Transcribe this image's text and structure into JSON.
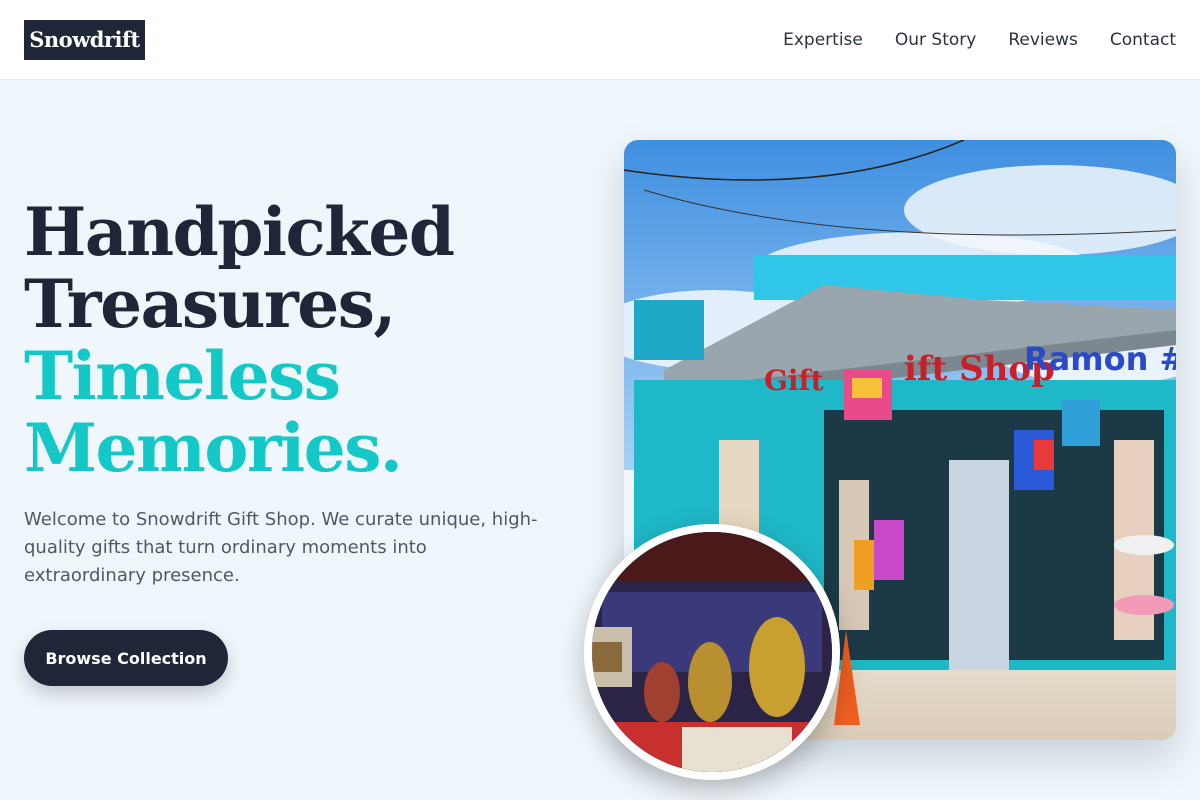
{
  "brand": {
    "name": "Snowdrift"
  },
  "nav": {
    "items": [
      "Expertise",
      "Our Story",
      "Reviews",
      "Contact"
    ]
  },
  "hero": {
    "headline_dark_line1": "Handpicked",
    "headline_dark_line2": "Treasures,",
    "headline_accent_line1": "Timeless",
    "headline_accent_line2": "Memories.",
    "intro": "Welcome to Snowdrift Gift Shop. We curate unique, high-quality gifts that turn ordinary moments into extraordinary presence.",
    "cta_label": "Browse Collection"
  },
  "images": {
    "main": "storefront-photo",
    "inset": "figurines-photo"
  },
  "colors": {
    "dark": "#1e2638",
    "accent": "#14c8c8",
    "background": "#f0f7fc"
  }
}
